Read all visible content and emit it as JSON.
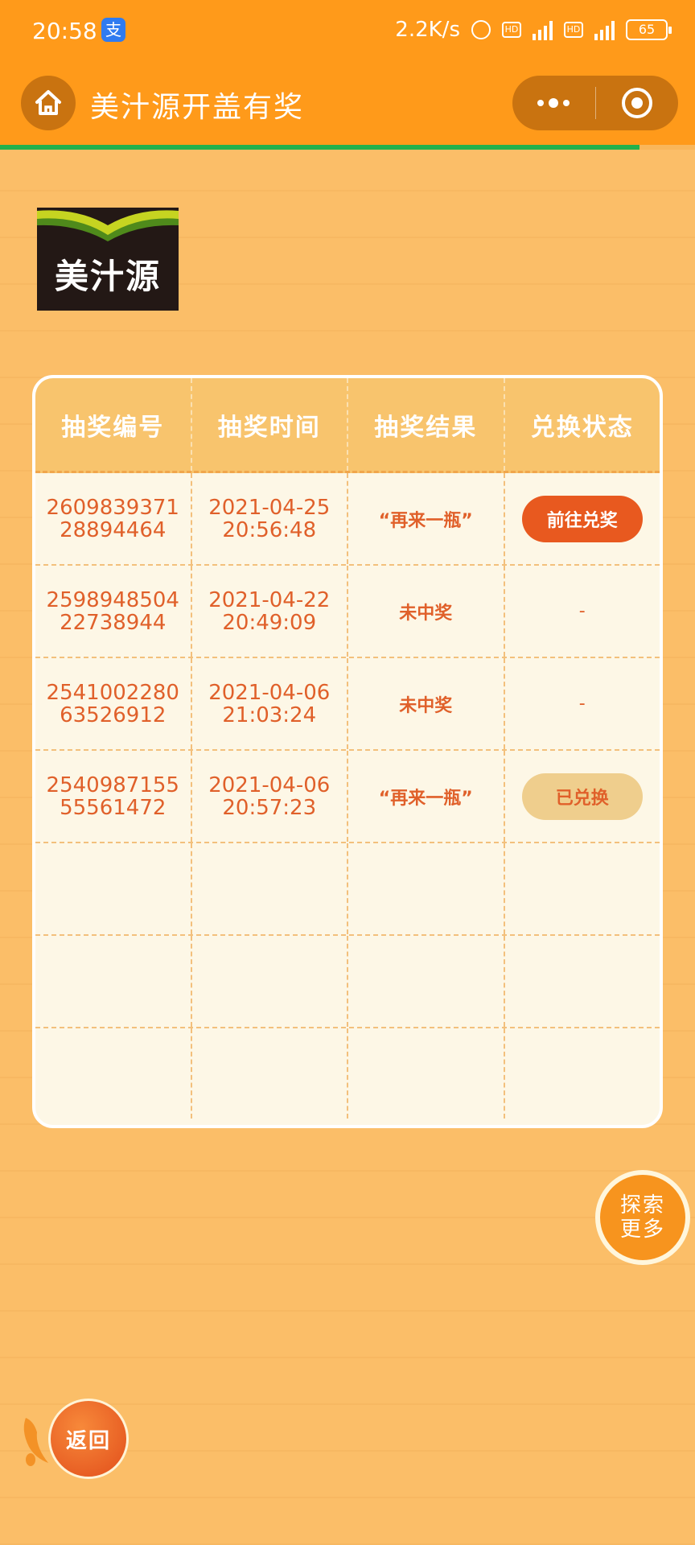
{
  "status_bar": {
    "time": "20:58",
    "network_speed": "2.2K/s",
    "hd_label": "HD",
    "battery": "65"
  },
  "nav": {
    "title": "美汁源开盖有奖",
    "progress_fraction": 0.92
  },
  "logo": {
    "text": "美汁源",
    "colors": {
      "background": "#231815",
      "leaf_light": "#c6d421",
      "leaf_dark": "#4f8a1b"
    }
  },
  "table": {
    "headers": [
      "抽奖编号",
      "抽奖时间",
      "抽奖结果",
      "兑换状态"
    ],
    "rows": [
      {
        "id_line1": "2609839371",
        "id_line2": "28894464",
        "date": "2021-04-25",
        "time": "20:56:48",
        "result": "“再来一瓶”",
        "status": "前往兑奖",
        "status_type": "action"
      },
      {
        "id_line1": "2598948504",
        "id_line2": "22738944",
        "date": "2021-04-22",
        "time": "20:49:09",
        "result": "未中奖",
        "status": "-",
        "status_type": "none"
      },
      {
        "id_line1": "2541002280",
        "id_line2": "63526912",
        "date": "2021-04-06",
        "time": "21:03:24",
        "result": "未中奖",
        "status": "-",
        "status_type": "none"
      },
      {
        "id_line1": "2540987155",
        "id_line2": "55561472",
        "date": "2021-04-06",
        "time": "20:57:23",
        "result": "“再来一瓶”",
        "status": "已兑换",
        "status_type": "done"
      }
    ],
    "empty_rows": 3
  },
  "floating": {
    "explore_line1": "探索",
    "explore_line2": "更多",
    "back": "返回"
  },
  "colors": {
    "top_bar": "#ff9a1a",
    "accent": "#e8591f",
    "text": "#e0602a",
    "progress": "#22b14c"
  }
}
